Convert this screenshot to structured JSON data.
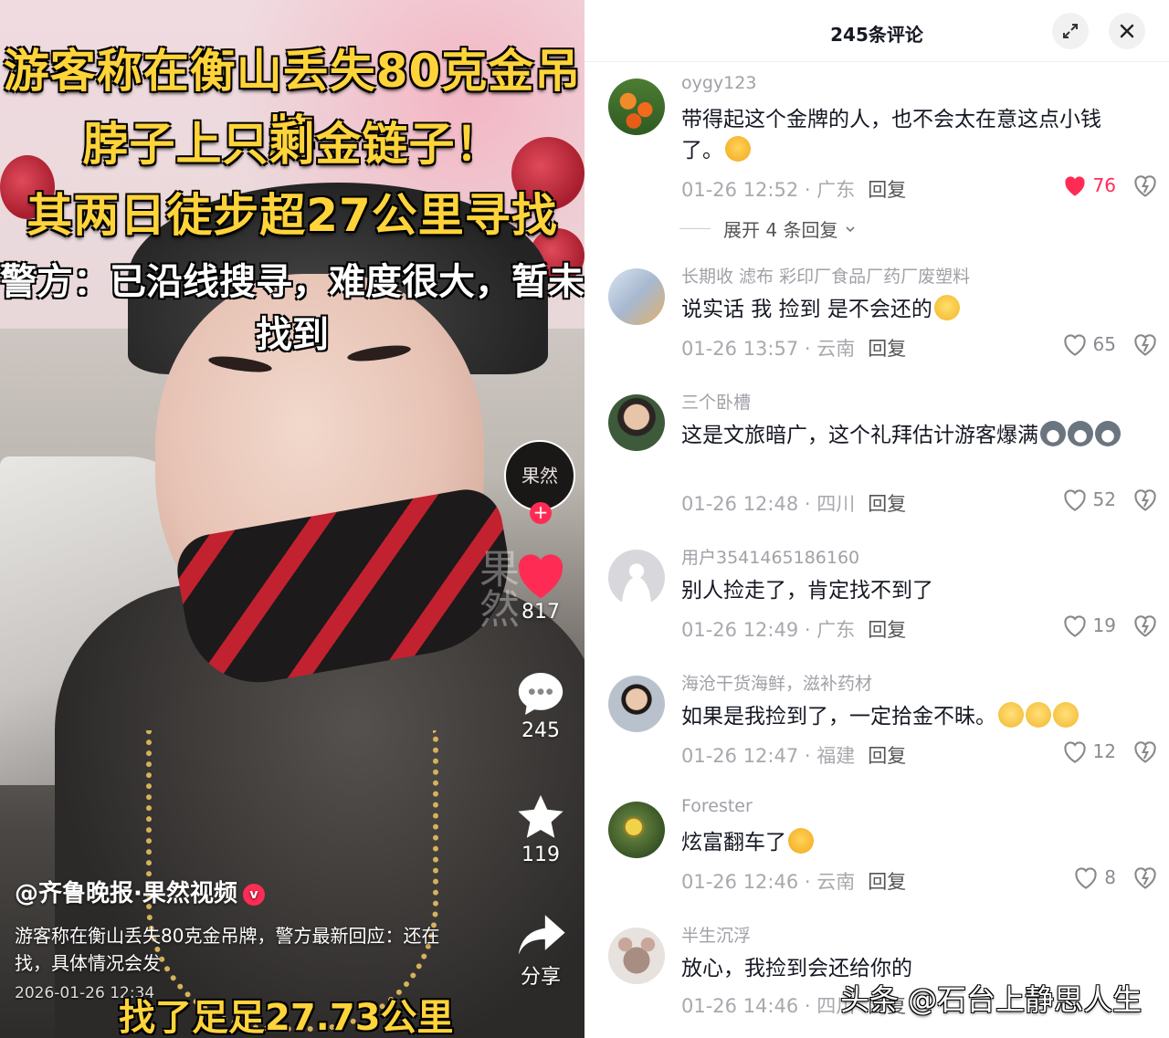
{
  "video": {
    "title_lines": [
      "游客称在衡山丢失80克金吊牌",
      "脖子上只剩金链子！",
      "其两日徒步超27公里寻找"
    ],
    "police_line": "警方：已沿线搜寻，难度很大，暂未找到",
    "author": "@齐鲁晚报·果然视频",
    "description": "游客称在衡山丢失80克金吊牌，警方最新回应：还在找，具体情况会发",
    "date": "2026-01-26 12:34",
    "bottom_caption": "找了足足27.73公里",
    "avatar_text": "果然",
    "side_watermark": "果然",
    "likes": "817",
    "comments": "245",
    "favorites": "119",
    "share_label": "分享"
  },
  "panel": {
    "title": "245条评论",
    "expand_replies": "展开 4 条回复"
  },
  "comments": [
    {
      "user": "oygy123",
      "text": "带得起这个金牌的人，也不会太在意这点小钱了。",
      "emoji": "cry",
      "date": "01-26 12:52",
      "region": "广东",
      "reply": "回复",
      "likes": "76",
      "liked": true
    },
    {
      "user": "长期收 滤布 彩印厂食品厂药厂废塑料",
      "text": "说实话 我 捡到 是不会还的",
      "emoji": "laugh",
      "date": "01-26 13:57",
      "region": "云南",
      "reply": "回复",
      "likes": "65",
      "liked": false
    },
    {
      "user": "三个卧槽",
      "text": "这是文旅暗广，这个礼拜估计游客爆满",
      "emoji": "husky",
      "date": "01-26 12:48",
      "region": "四川",
      "reply": "回复",
      "likes": "52",
      "liked": false
    },
    {
      "user": "用户3541465186160",
      "text": "别人捡走了，肯定找不到了",
      "emoji": "",
      "date": "01-26 12:49",
      "region": "广东",
      "reply": "回复",
      "likes": "19",
      "liked": false
    },
    {
      "user": "海沧干货海鲜，滋补药材",
      "text": "如果是我捡到了，一定拾金不昧。",
      "emoji": "grin",
      "date": "01-26 12:47",
      "region": "福建",
      "reply": "回复",
      "likes": "12",
      "liked": false
    },
    {
      "user": "Forester",
      "text": "炫富翻车了",
      "emoji": "cry",
      "date": "01-26 12:46",
      "region": "云南",
      "reply": "回复",
      "likes": "8",
      "liked": false
    },
    {
      "user": "半生沉浮",
      "text": "放心，我捡到会还给你的",
      "emoji": "",
      "date": "01-26 14:46",
      "region": "四川",
      "reply": "回复",
      "likes": "",
      "liked": false
    }
  ],
  "watermark": "头条 @石台上静思人生",
  "colors": {
    "accent": "#fe2c55",
    "title_yellow": "#ffd43a"
  }
}
